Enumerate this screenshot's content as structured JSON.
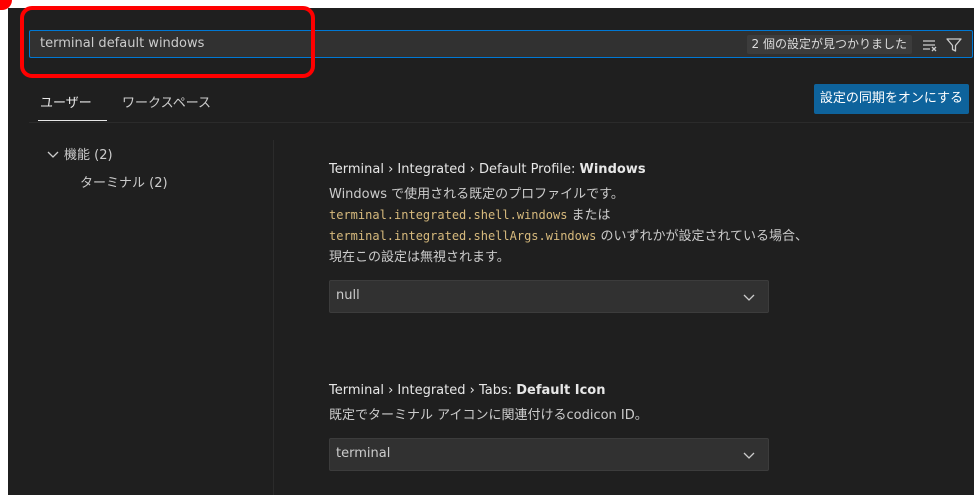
{
  "search": {
    "value": "terminal default windows",
    "result_count": "2 個の設定が見つかりました",
    "clear_icon": "clear-filter-icon",
    "filter_icon": "filter-icon"
  },
  "tabs": [
    {
      "label": "ユーザー",
      "active": true
    },
    {
      "label": "ワークスペース",
      "active": false
    }
  ],
  "sync_button": "設定の同期をオンにする",
  "toc": {
    "group": "機能 (2)",
    "items": [
      "ターミナル (2)"
    ]
  },
  "settings": [
    {
      "title_prefix": "Terminal › Integrated › Default Profile: ",
      "title_key": "Windows",
      "desc_line1": "Windows で使用される既定のプロファイルです。",
      "code1": "terminal.integrated.shell.windows",
      "desc_mid": " または",
      "code2": "terminal.integrated.shellArgs.windows",
      "desc_line3": " のいずれかが設定されている場合、",
      "desc_line4": "現在この設定は無視されます。",
      "value": "null"
    },
    {
      "title_prefix": "Terminal › Integrated › Tabs: ",
      "title_key": "Default Icon",
      "desc_line1": "既定でターミナル アイコンに関連付けるcodicon ID。",
      "value": "terminal"
    }
  ],
  "colors": {
    "accent": "#0078d4",
    "button": "#0e639c",
    "highlight": "#ff0000",
    "code": "#d7ba7d"
  }
}
